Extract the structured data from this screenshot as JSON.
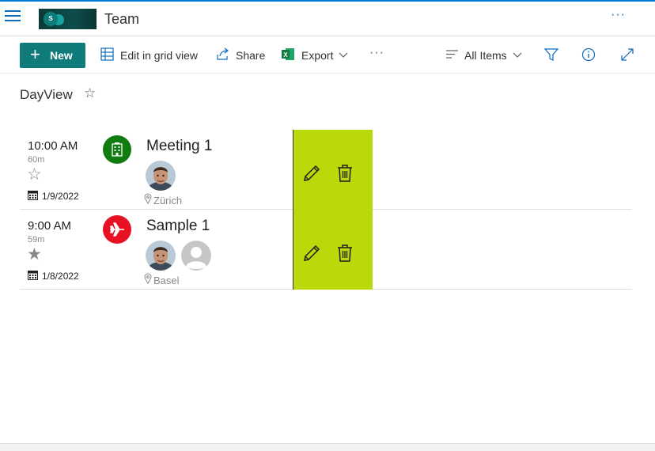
{
  "app": {
    "site_title": "Team",
    "logo_letter": "S",
    "accent_color": "#0f7b7a",
    "brand_line_color": "#0078d4"
  },
  "command_bar": {
    "new_label": "New",
    "edit_grid_label": "Edit in grid view",
    "share_label": "Share",
    "export_label": "Export",
    "view_label": "All Items"
  },
  "page": {
    "title": "DayView"
  },
  "events": [
    {
      "time": "10:00 AM",
      "duration": "60m",
      "starred": false,
      "star_glyph": "☆",
      "date": "1/9/2022",
      "title": "Meeting 1",
      "category_icon": "building-icon",
      "category_color": "#107c10",
      "attendees": [
        "person-photo"
      ],
      "location": "Zürich",
      "action_color": "#bad80a"
    },
    {
      "time": "9:00 AM",
      "duration": "59m",
      "starred": true,
      "star_glyph": "★",
      "date": "1/8/2022",
      "title": "Sample 1",
      "category_icon": "airplane-icon",
      "category_color": "#e81123",
      "attendees": [
        "person-photo",
        "person-placeholder"
      ],
      "location": "Basel",
      "action_color": "#bad80a"
    }
  ]
}
